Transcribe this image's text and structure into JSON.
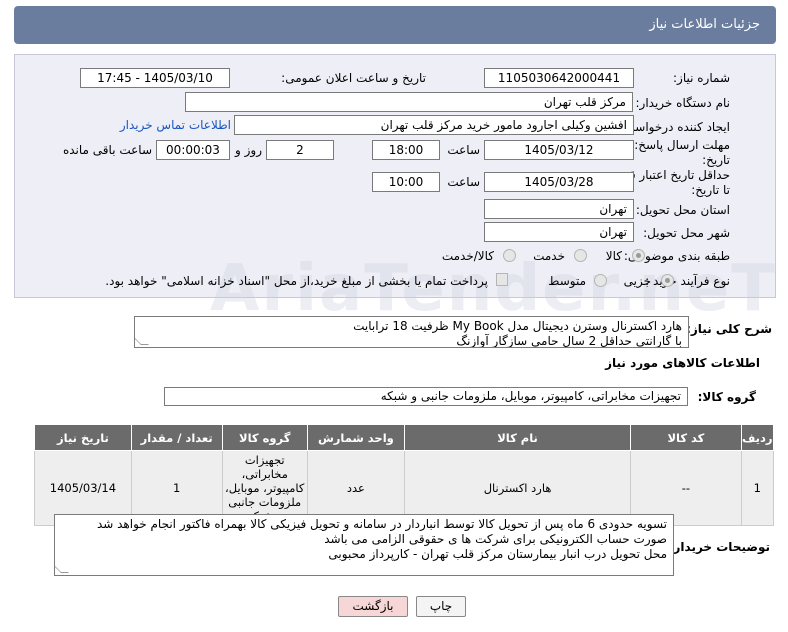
{
  "header": {
    "title": "جزئیات اطلاعات نیاز"
  },
  "form": {
    "need_number_label": "شماره نیاز:",
    "need_number": "1105030642000441",
    "announce_label": "تاریخ و ساعت اعلان عمومی:",
    "announce_value": "1405/03/10 - 17:45",
    "buyer_org_label": "نام دستگاه خریدار:",
    "buyer_org": "مرکز قلب تهران",
    "creator_label": "ایجاد کننده درخواست:",
    "creator": "افشین وکیلی اجارود مامور خرید مرکز قلب تهران",
    "contact_link": "اطلاعات تماس خریدار",
    "send_deadline_label_1": "مهلت ارسال پاسخ: تا",
    "send_deadline_label_2": "تاریخ:",
    "send_date": "1405/03/12",
    "time_label": "ساعت",
    "send_time": "18:00",
    "days_value": "2",
    "days_label": "روز و",
    "remaining_value": "00:00:03",
    "remaining_label": "ساعت باقی مانده",
    "price_validity_label_1": "حداقل تاریخ اعتبار قیمت:",
    "price_validity_label_2": "تا تاریخ:",
    "validity_date": "1405/03/28",
    "validity_time": "10:00",
    "province_label": "استان محل تحویل:",
    "province": "تهران",
    "city_label": "شهر محل تحویل:",
    "city": "تهران",
    "category_label": "طبقه بندی موضوعی:",
    "category_options": [
      "کالا",
      "خدمت",
      "کالا/خدمت"
    ],
    "purchase_type_label": "نوع فرآیند خرید :",
    "purchase_options": [
      "جزیی",
      "متوسط"
    ],
    "payment_note": "پرداخت تمام یا بخشی از مبلغ خرید،از محل \"اسناد خزانه اسلامی\" خواهد بود."
  },
  "description": {
    "label": "شرح کلی نیاز:",
    "line1": "هارد اکسترنال وسترن دیجیتال مدل My Book ظرفیت 18 ترابایت",
    "line2": "با گارانتی حداقل 2 سال حامی سازگار آوازنگ"
  },
  "goods_info": {
    "title": "اطلاعات کالاهای مورد نیاز",
    "group_label": "گروه کالا:",
    "group_value": "تجهیزات مخابراتی، کامپیوتر، موبایل، ملزومات جانبی و شبکه"
  },
  "table": {
    "headers": [
      "ردیف",
      "کد کالا",
      "نام کالا",
      "واحد شمارش",
      "گروه کالا",
      "تعداد / مقدار",
      "تاریخ نیاز"
    ],
    "rows": [
      {
        "row": "1",
        "code": "--",
        "name": "هارد اکسترنال",
        "unit": "عدد",
        "group": "تجهیزات مخابراتی، کامپیوتر، موبایل، ملزومات جانبی و شبکه",
        "qty": "1",
        "date": "1405/03/14"
      }
    ]
  },
  "buyer_notes": {
    "label": "توضیحات خریدار:",
    "line1": "تسویه حدودی 6 ماه پس از تحویل کالا توسط انباردار در سامانه و تحویل فیزیکی کالا بهمراه فاکتور انجام خواهد شد",
    "line2": "صورت حساب الکترونیکی برای شرکت ها ی حقوقی الزامی می باشد",
    "line3": "محل تحویل درب انبار بیمارستان مرکز قلب تهران - کارپرداز محبوبی"
  },
  "buttons": {
    "print": "چاپ",
    "back": "بازگشت"
  },
  "watermark": "AriaTender.neT",
  "colors": {
    "header": "#6b7d9e",
    "panel": "#eeeef6",
    "link": "#1a56c0",
    "back_button": "#f6d6d6"
  }
}
